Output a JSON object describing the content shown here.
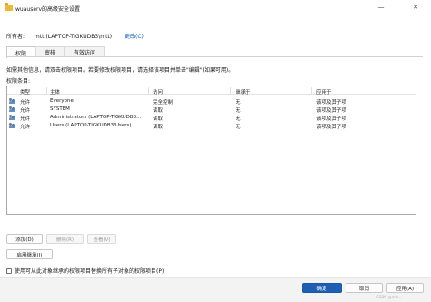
{
  "window": {
    "title": "wuauserv的高级安全设置",
    "minimize_symbol": "—",
    "close_symbol": "✕"
  },
  "owner": {
    "label": "所有者:",
    "value": "mtt (LAPTOP-TIGKUDB3\\mtt)",
    "change_label": "更改(C)"
  },
  "tabs": [
    {
      "label": "权限",
      "active": true
    },
    {
      "label": "审核",
      "active": false
    },
    {
      "label": "有效访问",
      "active": false
    }
  ],
  "info_text": "如需其他信息，请双击权限项目。若要修改权限项目，请选择该项目并单击\"编辑\"(如果可用)。",
  "entries_label": "权限条目:",
  "table": {
    "headers": [
      "类型",
      "主体",
      "访问",
      "继承于",
      "应用于"
    ],
    "rows": [
      {
        "type": "允许",
        "principal": "Everyone",
        "access": "完全控制",
        "inherited": "无",
        "applies": "该项及其子项"
      },
      {
        "type": "允许",
        "principal": "SYSTEM",
        "access": "读取",
        "inherited": "无",
        "applies": "该项及其子项"
      },
      {
        "type": "允许",
        "principal": "Administrators (LAPTOP-TIGKUDB3...",
        "access": "读取",
        "inherited": "无",
        "applies": "该项及其子项"
      },
      {
        "type": "允许",
        "principal": "Users (LAPTOP-TIGKUDB3\\Users)",
        "access": "读取",
        "inherited": "无",
        "applies": "该项及其子项"
      }
    ]
  },
  "buttons": {
    "add": "添加(D)",
    "remove": "删除(R)",
    "view": "查看(V)",
    "enable_inheritance": "启用继承(I)",
    "ok": "确定",
    "cancel": "取消",
    "apply": "应用(A)"
  },
  "replace_checkbox": {
    "label": "使用可从此对象继承的权限项目替换所有子对象的权限项目(P)",
    "checked": false
  },
  "watermark": "CSDN @mtt..."
}
